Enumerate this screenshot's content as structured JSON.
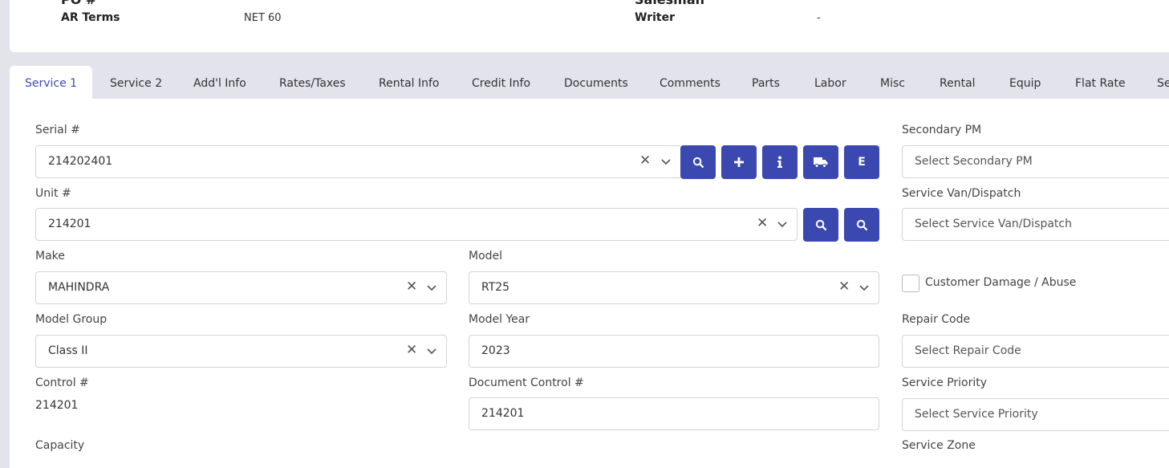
{
  "header": {
    "po_label": "PO #",
    "salesman_label": "Salesman",
    "ar_terms_label": "AR Terms",
    "ar_terms_value": "NET 60",
    "writer_label": "Writer",
    "writer_value": "-"
  },
  "tabs": [
    {
      "label": "Service 1"
    },
    {
      "label": "Service 2"
    },
    {
      "label": "Add'l Info"
    },
    {
      "label": "Rates/Taxes"
    },
    {
      "label": "Rental Info"
    },
    {
      "label": "Credit Info"
    },
    {
      "label": "Documents"
    },
    {
      "label": "Comments"
    },
    {
      "label": "Parts"
    },
    {
      "label": "Labor"
    },
    {
      "label": "Misc"
    },
    {
      "label": "Rental"
    },
    {
      "label": "Equip"
    },
    {
      "label": "Flat Rate"
    },
    {
      "label": "Se"
    }
  ],
  "active_tab": "Service 1",
  "form": {
    "serial": {
      "label": "Serial #",
      "value": "214202401"
    },
    "unit": {
      "label": "Unit #",
      "value": "214201"
    },
    "make": {
      "label": "Make",
      "value": "MAHINDRA"
    },
    "model": {
      "label": "Model",
      "value": "RT25"
    },
    "model_group": {
      "label": "Model Group",
      "value": "Class II"
    },
    "model_year": {
      "label": "Model Year",
      "value": "2023"
    },
    "control": {
      "label": "Control #",
      "value": "214201"
    },
    "document_control": {
      "label": "Document Control #",
      "value": "214201"
    },
    "capacity": {
      "label": "Capacity"
    },
    "secondary_pm": {
      "label": "Secondary PM",
      "placeholder": "Select Secondary PM"
    },
    "service_van": {
      "label": "Service Van/Dispatch",
      "placeholder": "Select Service Van/Dispatch"
    },
    "customer_damage": {
      "label": "Customer Damage / Abuse",
      "checked": false
    },
    "repair_code": {
      "label": "Repair Code",
      "placeholder": "Select Repair Code"
    },
    "service_priority": {
      "label": "Service Priority",
      "placeholder": "Select Service Priority"
    },
    "service_zone": {
      "label": "Service Zone"
    }
  },
  "serial_buttons": [
    "search-icon",
    "plus-icon",
    "info-icon",
    "truck-icon",
    "E"
  ],
  "serial_button_e_label": "E",
  "unit_buttons": [
    "search-icon",
    "search-icon"
  ],
  "colors": {
    "accent": "#3a48b0",
    "active_tab_text": "#3b4bb3",
    "background": "#e3e3ec"
  }
}
